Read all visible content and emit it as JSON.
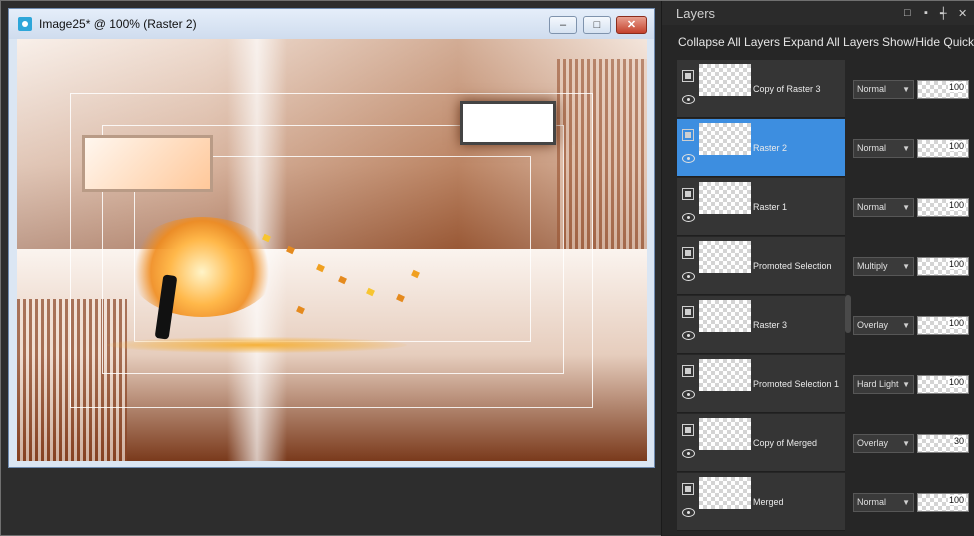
{
  "window": {
    "title": "Image25* @ 100% (Raster 2)",
    "buttons": {
      "minimize": "–",
      "maximize": "□",
      "close": "✕"
    }
  },
  "colors": {
    "selection": "#3d8ee0",
    "panel_bg": "#262626",
    "close_button": "#c4412c"
  },
  "layers_panel": {
    "title": "Layers",
    "header_icons": {
      "float": "□",
      "pin": "▪",
      "dock": "┽",
      "close": "✕"
    },
    "toolbar": {
      "collapse": "Collapse All Layers",
      "expand": "Expand All Layers",
      "showhide": "Show/Hide Quick"
    },
    "layers": [
      {
        "name": "Copy of Raster 3",
        "blend": "Normal",
        "opacity": "100",
        "selected": false
      },
      {
        "name": "Raster 2",
        "blend": "Normal",
        "opacity": "100",
        "selected": true
      },
      {
        "name": "Raster 1",
        "blend": "Normal",
        "opacity": "100",
        "selected": false
      },
      {
        "name": "Promoted Selection",
        "blend": "Multiply",
        "opacity": "100",
        "selected": false
      },
      {
        "name": "Raster 3",
        "blend": "Overlay",
        "opacity": "100",
        "selected": false
      },
      {
        "name": "Promoted Selection 1",
        "blend": "Hard Light",
        "opacity": "100",
        "selected": false
      },
      {
        "name": "Copy of Merged",
        "blend": "Overlay",
        "opacity": "30",
        "selected": false
      },
      {
        "name": "Merged",
        "blend": "Normal",
        "opacity": "100",
        "selected": false
      }
    ]
  }
}
